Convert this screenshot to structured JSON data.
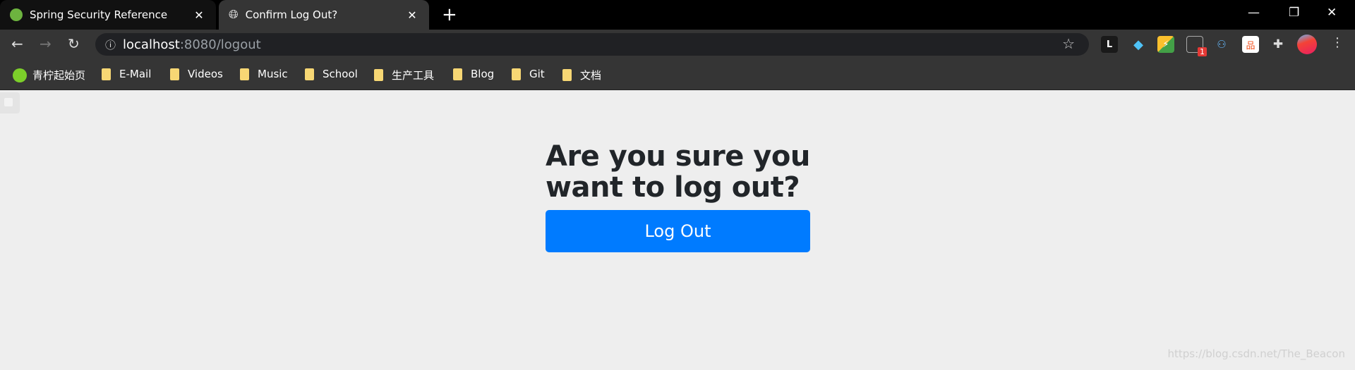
{
  "tabs": [
    {
      "title": "Spring Security Reference",
      "icon": "spring-leaf-icon",
      "active": false
    },
    {
      "title": "Confirm Log Out?",
      "icon": "globe-icon",
      "active": true
    }
  ],
  "address": {
    "host": "localhost",
    "rest": ":8080/logout"
  },
  "extensions": [
    {
      "icon": "L-ext-icon",
      "badge": ""
    },
    {
      "icon": "diamond-ext-icon",
      "badge": ""
    },
    {
      "icon": "lightning-ext-icon",
      "badge": ""
    },
    {
      "icon": "camera-ext-icon",
      "badge": "1"
    },
    {
      "icon": "glasses-ext-icon",
      "badge": ""
    },
    {
      "icon": "sitemap-ext-icon",
      "badge": ""
    },
    {
      "icon": "puzzle-icon",
      "badge": ""
    },
    {
      "icon": "profile-avatar",
      "badge": ""
    }
  ],
  "bookmarks": [
    "青柠起始页",
    "E-Mail",
    "Videos",
    "Music",
    "School",
    "生产工具",
    "Blog",
    "Git",
    "文档"
  ],
  "page": {
    "heading": "Are you sure you want to log out?",
    "button": "Log Out",
    "button_color": "#007bff"
  },
  "watermark": "https://blog.csdn.net/The_Beacon"
}
